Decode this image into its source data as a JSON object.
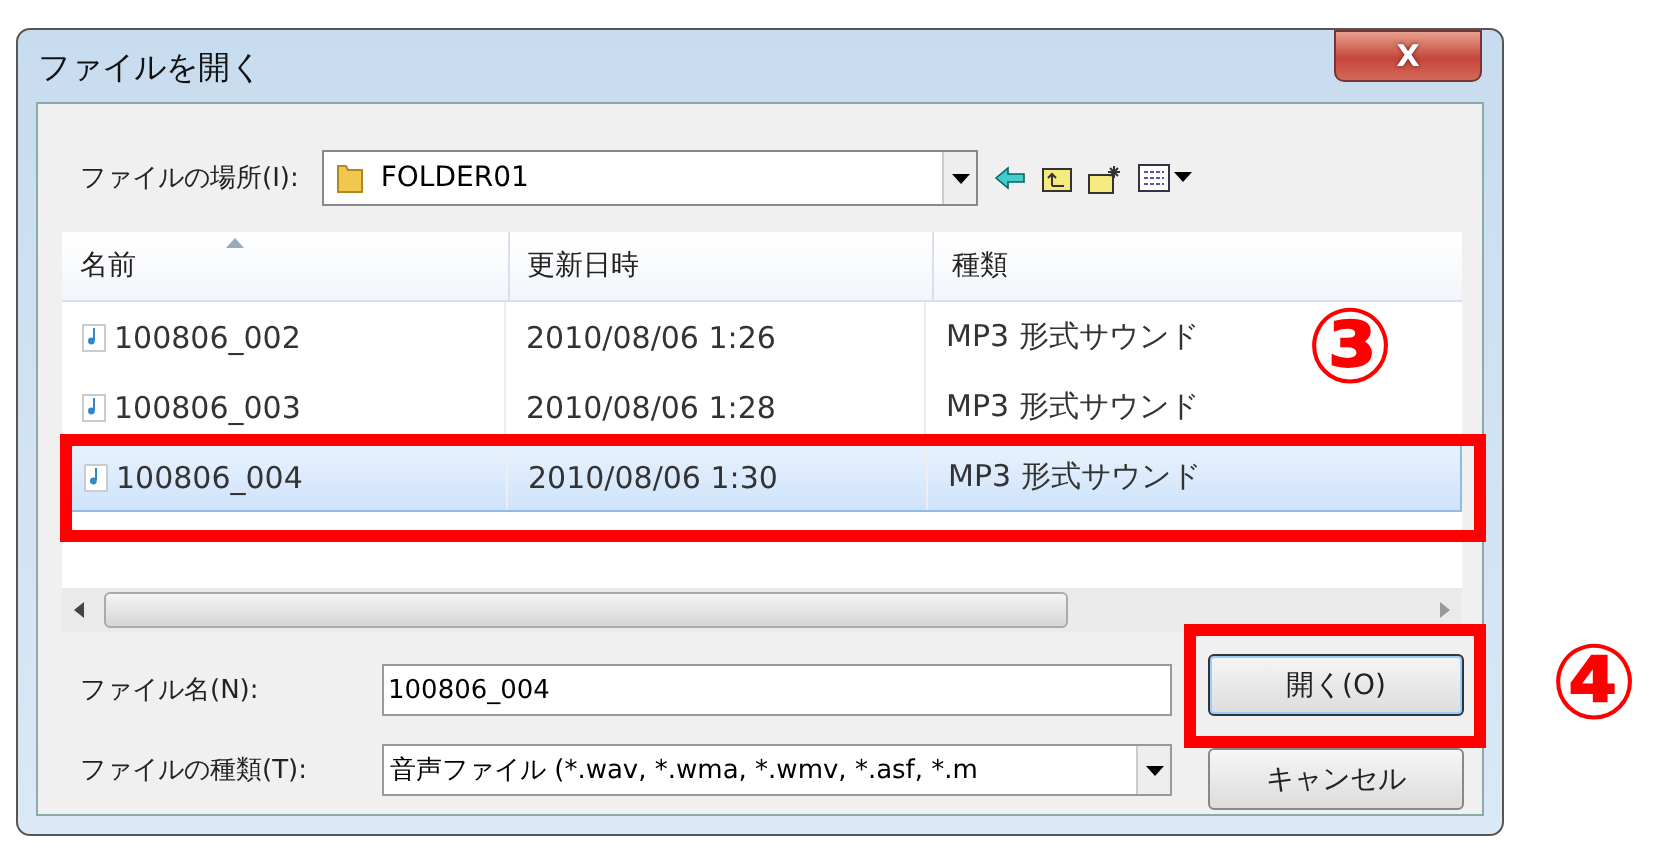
{
  "window": {
    "title": "ファイルを開く",
    "close_label": "X"
  },
  "location": {
    "label": "ファイルの場所(I):",
    "value": "FOLDER01"
  },
  "table": {
    "columns": [
      "名前",
      "更新日時",
      "種類"
    ],
    "rows": [
      {
        "name": "100806_002",
        "modified": "2010/08/06 1:26",
        "type": "MP3 形式サウンド",
        "selected": false
      },
      {
        "name": "100806_003",
        "modified": "2010/08/06 1:28",
        "type": "MP3 形式サウンド",
        "selected": false
      },
      {
        "name": "100806_004",
        "modified": "2010/08/06 1:30",
        "type": "MP3 形式サウンド",
        "selected": true
      }
    ]
  },
  "filename": {
    "label": "ファイル名(N):",
    "value": "100806_004"
  },
  "filetype": {
    "label": "ファイルの種類(T):",
    "value": "音声ファイル (*.wav, *.wma, *.wmv, *.asf, *.m"
  },
  "buttons": [
    {
      "label": "開く(O)",
      "kind": "open"
    },
    {
      "label": "キャンセル",
      "kind": "cancel"
    }
  ],
  "annotations": [
    {
      "kind": "step",
      "label": "③"
    },
    {
      "kind": "step",
      "label": "④"
    }
  ]
}
